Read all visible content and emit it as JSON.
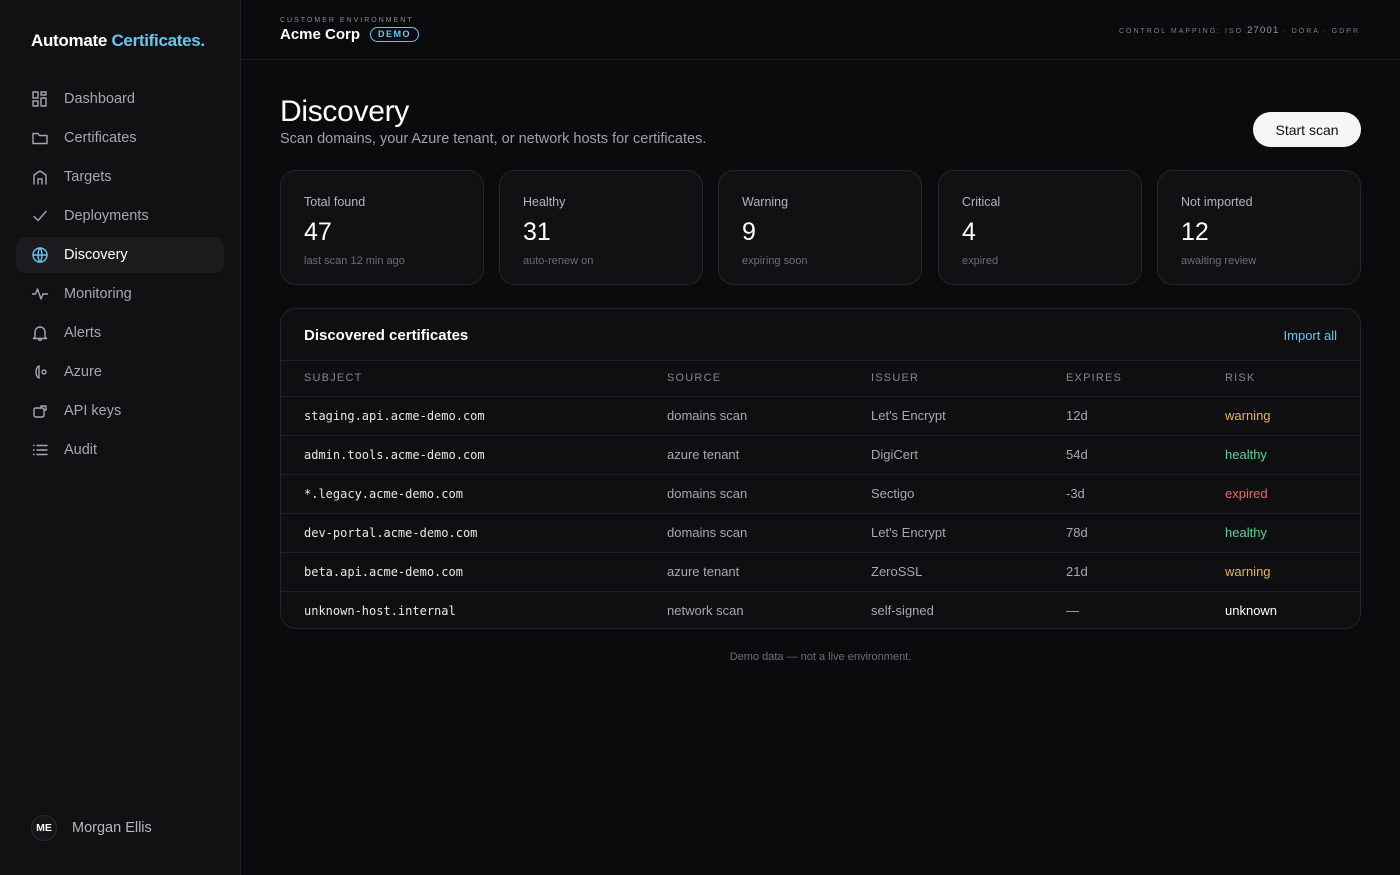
{
  "brand": {
    "part1": "Automate",
    "part2": "Certificates."
  },
  "sidebar": {
    "items": [
      {
        "label": "Dashboard",
        "icon": "grid-icon"
      },
      {
        "label": "Certificates",
        "icon": "folder-icon"
      },
      {
        "label": "Targets",
        "icon": "building-icon"
      },
      {
        "label": "Deployments",
        "icon": "check-icon"
      },
      {
        "label": "Discovery",
        "icon": "globe-icon",
        "active": true
      },
      {
        "label": "Monitoring",
        "icon": "activity-icon"
      },
      {
        "label": "Alerts",
        "icon": "bell-icon"
      },
      {
        "label": "Azure",
        "icon": "azure-icon"
      },
      {
        "label": "API keys",
        "icon": "key-icon"
      },
      {
        "label": "Audit",
        "icon": "list-icon"
      }
    ],
    "user": {
      "initials": "ME",
      "name": "Morgan Ellis"
    }
  },
  "topbar": {
    "env_label": "Customer environment",
    "env_name": "Acme Corp",
    "badge": "DEMO",
    "control_prefix": "Control mapping: ISO",
    "control_iso": "27001",
    "control_suffix": "· DORA · GDPR"
  },
  "main": {
    "title": "Discovery",
    "subtitle": "Scan domains, your Azure tenant, or network hosts for certificates.",
    "start_scan": "Start scan",
    "stats": [
      {
        "label": "Total found",
        "value": "47",
        "hint": "last scan 12 min ago"
      },
      {
        "label": "Healthy",
        "value": "31",
        "hint": "auto-renew on"
      },
      {
        "label": "Warning",
        "value": "9",
        "hint": "expiring soon"
      },
      {
        "label": "Critical",
        "value": "4",
        "hint": "expired"
      },
      {
        "label": "Not imported",
        "value": "12",
        "hint": "awaiting review"
      }
    ],
    "table": {
      "title": "Discovered certificates",
      "import_all": "Import all",
      "columns": [
        "Subject",
        "Source",
        "Issuer",
        "Expires",
        "Risk"
      ],
      "rows": [
        {
          "subject": "staging.api.acme-demo.com",
          "source": "domains scan",
          "issuer": "Let's Encrypt",
          "expires": "12d",
          "risk": "warning"
        },
        {
          "subject": "admin.tools.acme-demo.com",
          "source": "azure tenant",
          "issuer": "DigiCert",
          "expires": "54d",
          "risk": "healthy"
        },
        {
          "subject": "*.legacy.acme-demo.com",
          "source": "domains scan",
          "issuer": "Sectigo",
          "expires": "-3d",
          "risk": "expired"
        },
        {
          "subject": "dev-portal.acme-demo.com",
          "source": "domains scan",
          "issuer": "Let's Encrypt",
          "expires": "78d",
          "risk": "healthy"
        },
        {
          "subject": "beta.api.acme-demo.com",
          "source": "azure tenant",
          "issuer": "ZeroSSL",
          "expires": "21d",
          "risk": "warning"
        },
        {
          "subject": "unknown-host.internal",
          "source": "network scan",
          "issuer": "self-signed",
          "expires": "—",
          "risk": "unknown"
        }
      ]
    },
    "footer_note": "Demo data — not a live environment."
  },
  "colors": {
    "accent": "#6cc4ee",
    "warning": "#e2b455",
    "healthy": "#5fcf98",
    "expired": "#e56a6a"
  }
}
